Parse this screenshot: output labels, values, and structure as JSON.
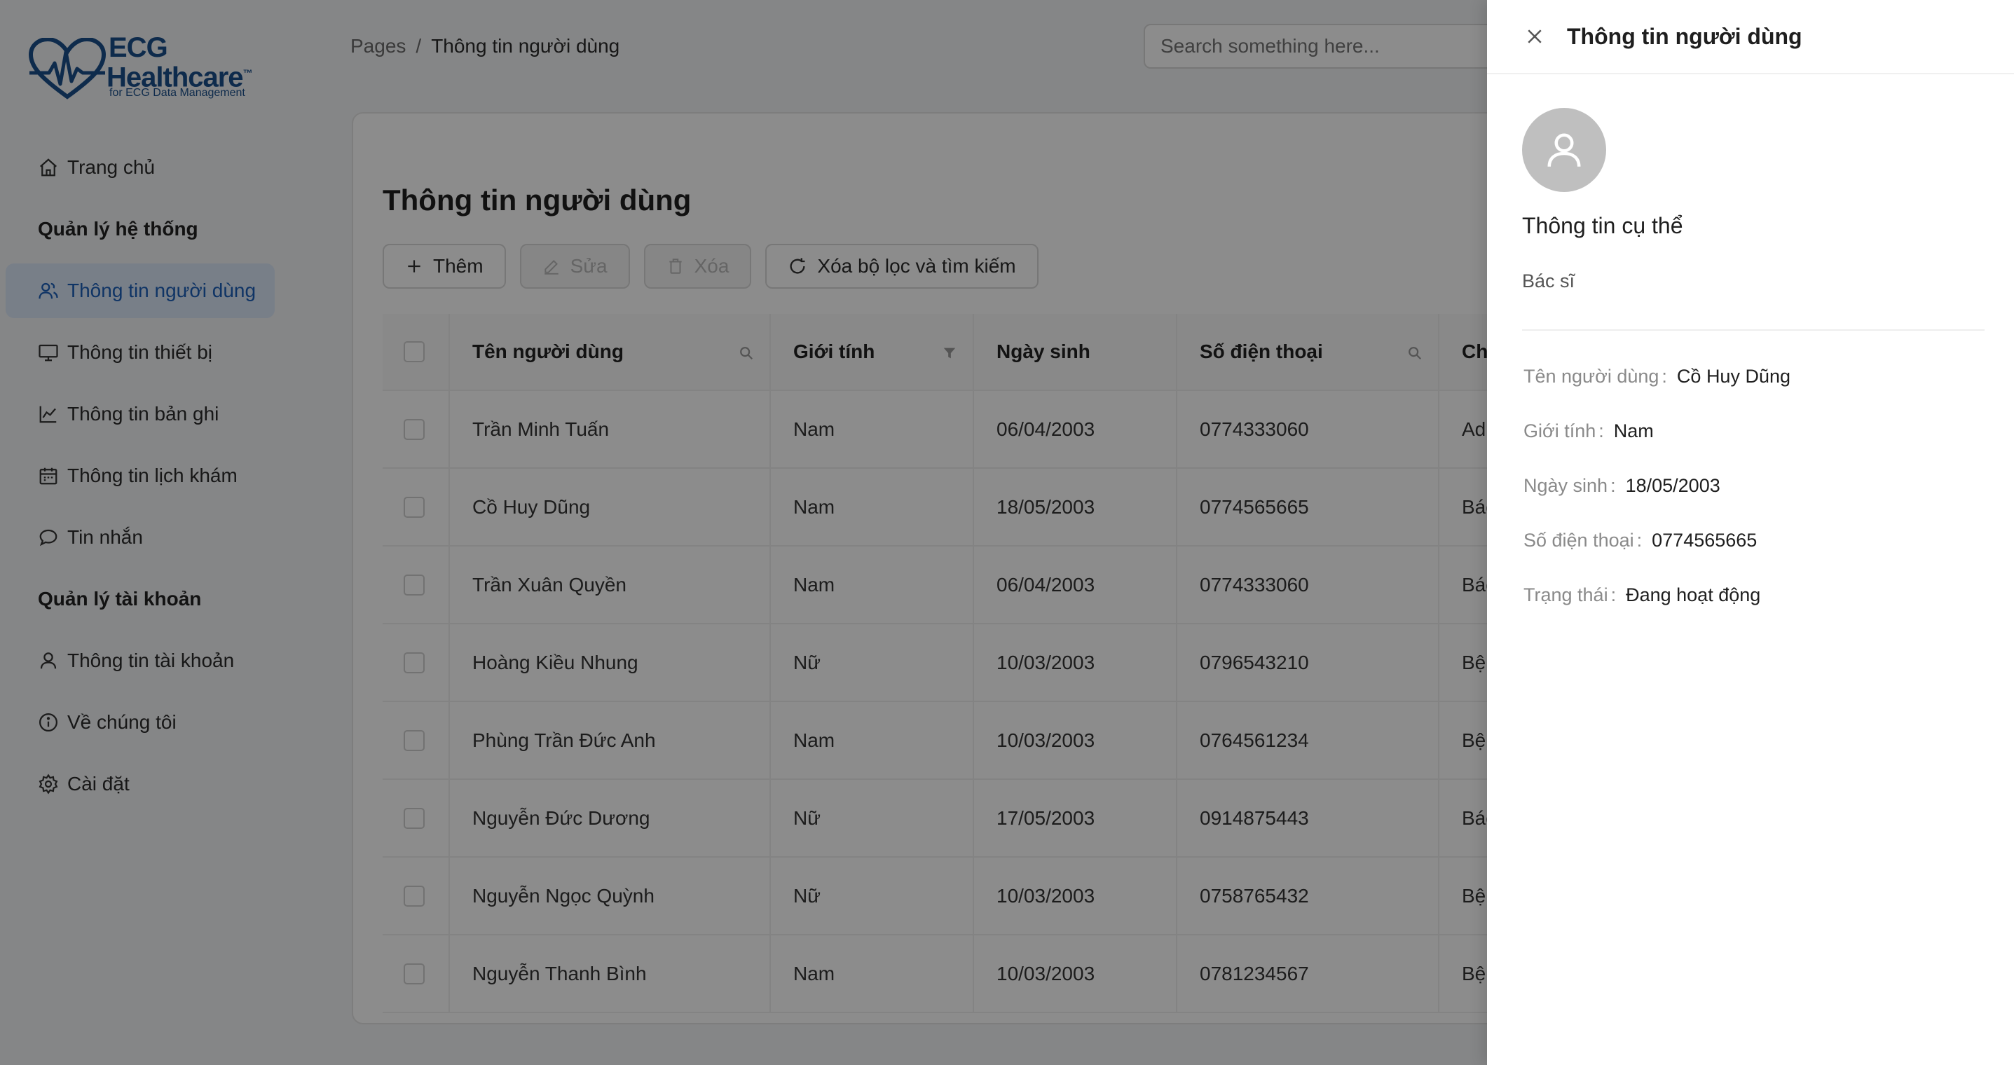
{
  "logo": {
    "line1": "ECG",
    "line2": "Healthcare",
    "tm": "™",
    "subtitle": "for ECG Data Management"
  },
  "sidebar": {
    "home": "Trang chủ",
    "group_system": "Quản lý hệ thống",
    "users": "Thông tin người dùng",
    "devices": "Thông tin thiết bị",
    "records": "Thông tin bản ghi",
    "schedule": "Thông tin lịch khám",
    "messages": "Tin nhắn",
    "group_account": "Quản lý tài khoản",
    "account": "Thông tin tài khoản",
    "about": "Về chúng tôi",
    "settings": "Cài đặt"
  },
  "breadcrumb": {
    "root": "Pages",
    "sep": "/",
    "current": "Thông tin người dùng"
  },
  "search": {
    "placeholder": "Search something here..."
  },
  "main": {
    "title": "Thông tin người dùng",
    "buttons": {
      "add": "Thêm",
      "edit": "Sửa",
      "delete": "Xóa",
      "reset": "Xóa bộ lọc và tìm kiếm"
    }
  },
  "table": {
    "headers": {
      "name": "Tên người dùng",
      "gender": "Giới tính",
      "dob": "Ngày sinh",
      "phone": "Số điện thoại",
      "role": "Chu"
    },
    "rows": [
      {
        "name": "Trần Minh Tuấn",
        "gender": "Nam",
        "dob": "06/04/2003",
        "phone": "0774333060",
        "role": "Adı"
      },
      {
        "name": "Cồ Huy Dũng",
        "gender": "Nam",
        "dob": "18/05/2003",
        "phone": "0774565665",
        "role": "Bác"
      },
      {
        "name": "Trần Xuân Quyền",
        "gender": "Nam",
        "dob": "06/04/2003",
        "phone": "0774333060",
        "role": "Bác"
      },
      {
        "name": "Hoàng Kiều Nhung",
        "gender": "Nữ",
        "dob": "10/03/2003",
        "phone": "0796543210",
        "role": "Bện"
      },
      {
        "name": "Phùng Trần Đức Anh",
        "gender": "Nam",
        "dob": "10/03/2003",
        "phone": "0764561234",
        "role": "Bện"
      },
      {
        "name": "Nguyễn Đức Dương",
        "gender": "Nữ",
        "dob": "17/05/2003",
        "phone": "0914875443",
        "role": "Bác"
      },
      {
        "name": "Nguyễn Ngọc Quỳnh",
        "gender": "Nữ",
        "dob": "10/03/2003",
        "phone": "0758765432",
        "role": "Bện"
      },
      {
        "name": "Nguyễn Thanh Bình",
        "gender": "Nam",
        "dob": "10/03/2003",
        "phone": "0781234567",
        "role": "Bện"
      }
    ]
  },
  "drawer": {
    "title": "Thông tin người dùng",
    "section_title": "Thông tin cụ thể",
    "role": "Bác sĩ",
    "fields": [
      {
        "label": "Tên người dùng",
        "value": "Cồ Huy Dũng"
      },
      {
        "label": "Giới tính",
        "value": "Nam"
      },
      {
        "label": "Ngày sinh",
        "value": "18/05/2003"
      },
      {
        "label": "Số điện thoại",
        "value": "0774565665"
      },
      {
        "label": "Trạng thái",
        "value": "Đang hoạt động"
      }
    ]
  },
  "colors": {
    "brand": "#1b4f8a",
    "active_bg": "#dbe7f7",
    "active_text": "#1d5fb8",
    "overlay": "rgba(0,0,0,0.45)"
  }
}
